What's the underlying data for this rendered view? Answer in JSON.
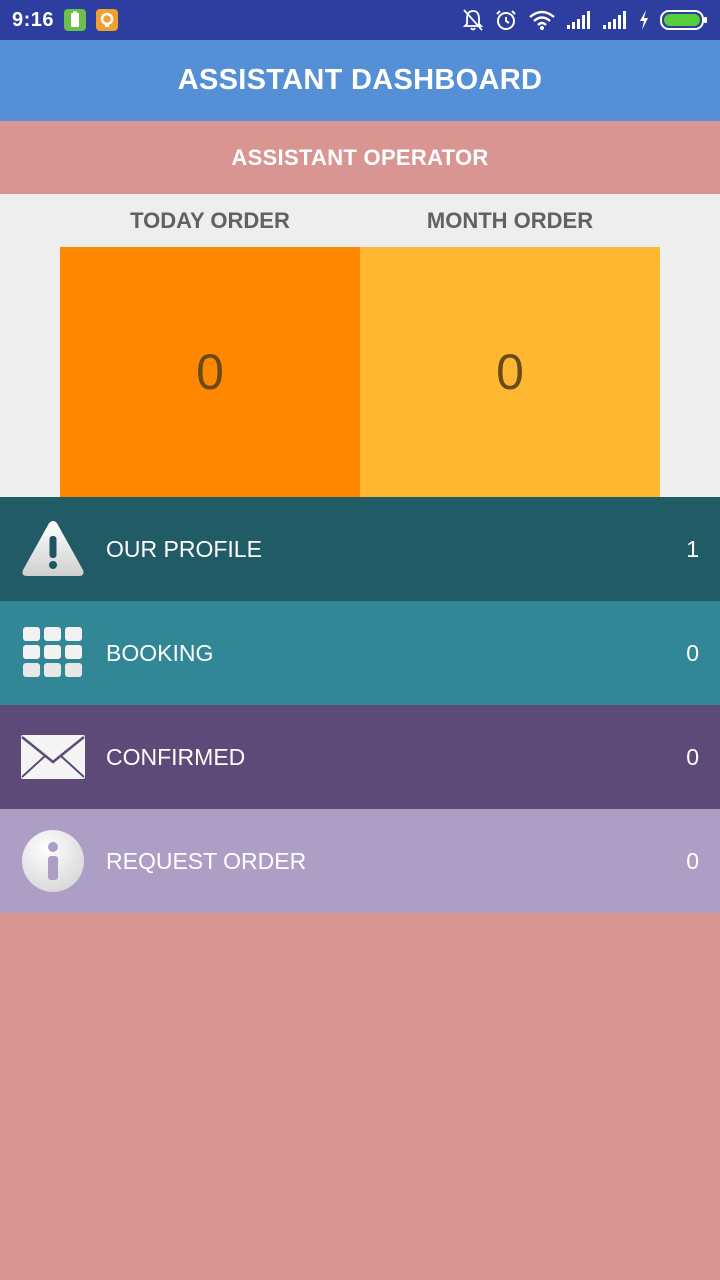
{
  "status_bar": {
    "time": "9:16",
    "background": "#2d3ea0"
  },
  "header": {
    "title": "ASSISTANT DASHBOARD",
    "background": "#558fd6"
  },
  "role": {
    "label": "ASSISTANT OPERATOR",
    "background": "#d99592"
  },
  "stats": {
    "today_label": "TODAY ORDER",
    "today_value": "0",
    "today_color": "#ff8800",
    "month_label": "MONTH ORDER",
    "month_value": "0",
    "month_color": "#ffb732"
  },
  "menu": [
    {
      "label": "OUR PROFILE",
      "count": "1",
      "icon": "warning-icon",
      "background": "#215b66"
    },
    {
      "label": "BOOKING",
      "count": "0",
      "icon": "grid-icon",
      "background": "#318796"
    },
    {
      "label": "CONFIRMED",
      "count": "0",
      "icon": "envelope-icon",
      "background": "#5e4a78"
    },
    {
      "label": "REQUEST ORDER",
      "count": "0",
      "icon": "info-icon",
      "background": "#ad9ec6"
    }
  ],
  "page_background": "#d99592"
}
